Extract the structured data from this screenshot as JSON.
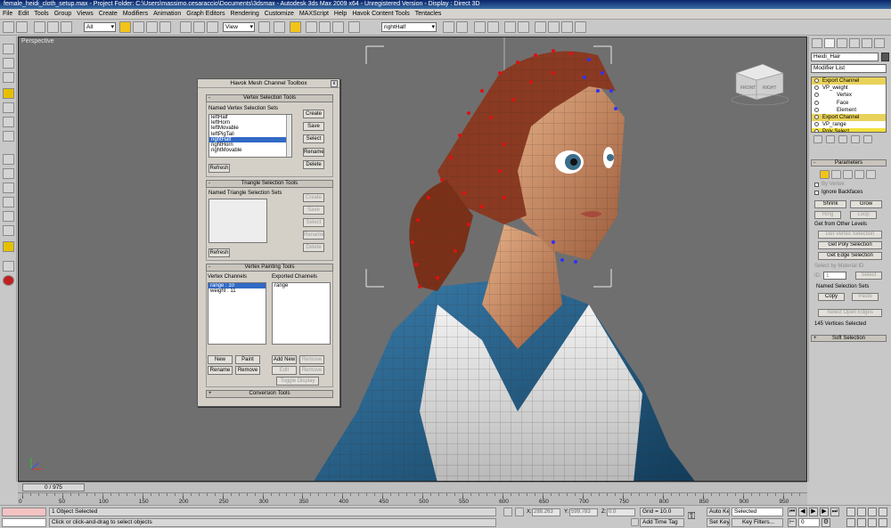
{
  "window": {
    "title": "female_heidi_cloth_setup.max   - Project Folder: C:\\Users\\massimo.cesaraccio\\Documents\\3dsmax    - Autodesk 3ds Max  2009 x64   -  Unregistered Version    - Display : Direct 3D"
  },
  "menu": [
    "File",
    "Edit",
    "Tools",
    "Group",
    "Views",
    "Create",
    "Modifiers",
    "Animation",
    "Graph Editors",
    "Rendering",
    "Customize",
    "MAXScript",
    "Help",
    "Havok Content Tools",
    "Tentacles"
  ],
  "toolbar": {
    "selection_filter": "All",
    "ref_coord": "View",
    "named_selection": "rightHalf"
  },
  "viewport": {
    "label": "Perspective",
    "viewcube_front": "FRONT",
    "viewcube_right": "RIGHT"
  },
  "dialog": {
    "title": "Havok Mesh Channel Toolbox",
    "close": "x",
    "vertex_section": {
      "header": "Vertex Selection Tools",
      "toggle": "-",
      "list_label": "Named Vertex Selection Sets",
      "items": [
        "leftHalf",
        "leftHorn",
        "leftMovable",
        "leftPigTail",
        "rightHalf",
        "rightHorn",
        "rightMovable"
      ],
      "selected_index": 4,
      "buttons": {
        "create": "Create",
        "save": "Save",
        "select": "Select",
        "rename": "Rename",
        "delete": "Delete",
        "refresh": "Refresh"
      }
    },
    "triangle_section": {
      "header": "Triangle Selection Tools",
      "toggle": "-",
      "list_label": "Named Triangle Selection Sets",
      "buttons": {
        "create": "Create",
        "save": "Save",
        "select": "Select",
        "rename": "Rename",
        "delete": "Delete",
        "refresh": "Refresh"
      }
    },
    "painting_section": {
      "header": "Vertex Painting Tools",
      "toggle": "-",
      "channels_label": "Vertex Channels",
      "channels": [
        "range : 10",
        "weight : 11"
      ],
      "exported_label": "Exported Channels",
      "exported": [
        "range"
      ],
      "buttons": {
        "new": "New",
        "paint": "Paint",
        "rename": "Rename",
        "remove": "Remove",
        "add_new": "Add New",
        "remove2": "Remove",
        "edit": "Edit",
        "remove3": "Remove",
        "toggle_display": "Toggle Display"
      }
    },
    "conversion_section": {
      "header": "Conversion Tools",
      "toggle": "+"
    }
  },
  "command_panel": {
    "object_name": "Heidi_Hair",
    "modifier_list": "Modifier List",
    "stack": [
      {
        "label": "Export Channel",
        "style": "y",
        "indent": 1
      },
      {
        "label": "VP_weight",
        "style": "n",
        "indent": 1
      },
      {
        "label": "Vertex",
        "style": "n",
        "indent": 3
      },
      {
        "label": "Face",
        "style": "n",
        "indent": 3
      },
      {
        "label": "Element",
        "style": "n",
        "indent": 3
      },
      {
        "label": "Export Channel",
        "style": "y",
        "indent": 1
      },
      {
        "label": "VP_range",
        "style": "n",
        "indent": 1
      },
      {
        "label": "Poly Select",
        "style": "hi",
        "indent": 1
      }
    ],
    "parameters_header": "Parameters",
    "by_vertex": "By Vertex",
    "ignore_backfaces": "Ignore Backfaces",
    "shrink": "Shrink",
    "grow": "Grow",
    "ring": "Ring",
    "loop": "Loop",
    "get_from_other": "Get from Other Levels",
    "get_vertex_sel": "Get Vertex Selection",
    "get_poly_sel": "Get Poly Selection",
    "get_edge_sel": "Get Edge Selection",
    "select_by_material": "Select by Material ID",
    "id_label": "ID:",
    "id_value": "1",
    "select_btn": "Select",
    "named_sel_sets": "Named Selection Sets",
    "copy": "Copy",
    "paste": "Paste",
    "select_open_edges": "Select Open Edges",
    "selected_count": "145 Vertices Selected",
    "soft_selection_header": "Soft Selection"
  },
  "timeline": {
    "slider": "0 / 975",
    "ticks": [
      "0",
      "50",
      "100",
      "150",
      "200",
      "250",
      "300",
      "350",
      "400",
      "450",
      "500",
      "550",
      "600",
      "650",
      "700",
      "750",
      "800",
      "850",
      "900",
      "950"
    ]
  },
  "status": {
    "objects_selected": "1 Object Selected",
    "prompt": "Click or click-and-drag to select objects",
    "x_label": "X:",
    "x_value": "288.263",
    "y_label": "Y:",
    "y_value": "599.783",
    "z_label": "Z:",
    "z_value": "0.0",
    "grid": "Grid = 10.0",
    "add_time_tag": "Add Time Tag",
    "auto_key": "Auto Key",
    "set_key": "Set Key",
    "key_mode": "Selected",
    "key_filters": "Key Filters...",
    "frame": "0"
  }
}
